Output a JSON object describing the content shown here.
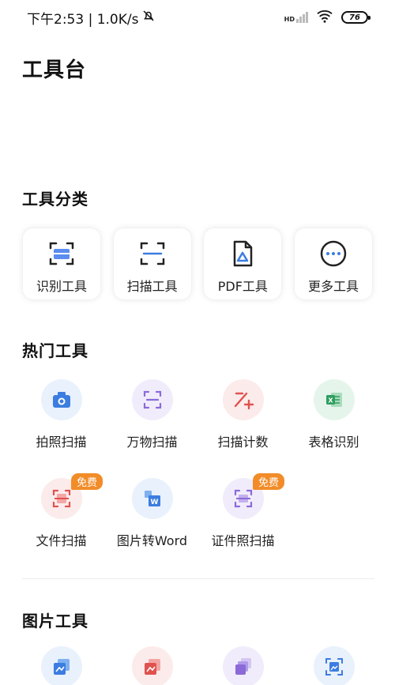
{
  "status_bar": {
    "time_speed": "下午2:53 | 1.0K/s",
    "network": "HD",
    "battery": "76"
  },
  "page_title": "工具台",
  "sections": {
    "categories_title": "工具分类",
    "hot_title": "热门工具",
    "image_title": "图片工具"
  },
  "categories": [
    {
      "label": "识别工具",
      "icon": "recognize-icon"
    },
    {
      "label": "扫描工具",
      "icon": "scan-frame-icon"
    },
    {
      "label": "PDF工具",
      "icon": "pdf-icon"
    },
    {
      "label": "更多工具",
      "icon": "more-icon"
    }
  ],
  "hot_tools": [
    {
      "label": "拍照扫描",
      "icon": "camera-icon"
    },
    {
      "label": "万物扫描",
      "icon": "scan-icon"
    },
    {
      "label": "扫描计数",
      "icon": "count-icon"
    },
    {
      "label": "表格识别",
      "icon": "excel-icon"
    },
    {
      "label": "文件扫描",
      "icon": "file-scan-icon",
      "badge": "免费"
    },
    {
      "label": "图片转Word",
      "icon": "word-icon"
    },
    {
      "label": "证件照扫描",
      "icon": "id-scan-icon",
      "badge": "免费"
    }
  ],
  "colors": {
    "blue": "#3b7de0",
    "purple": "#8b6ad8",
    "red": "#e0524f",
    "green": "#2e9e5e",
    "badge": "#f28c28"
  }
}
